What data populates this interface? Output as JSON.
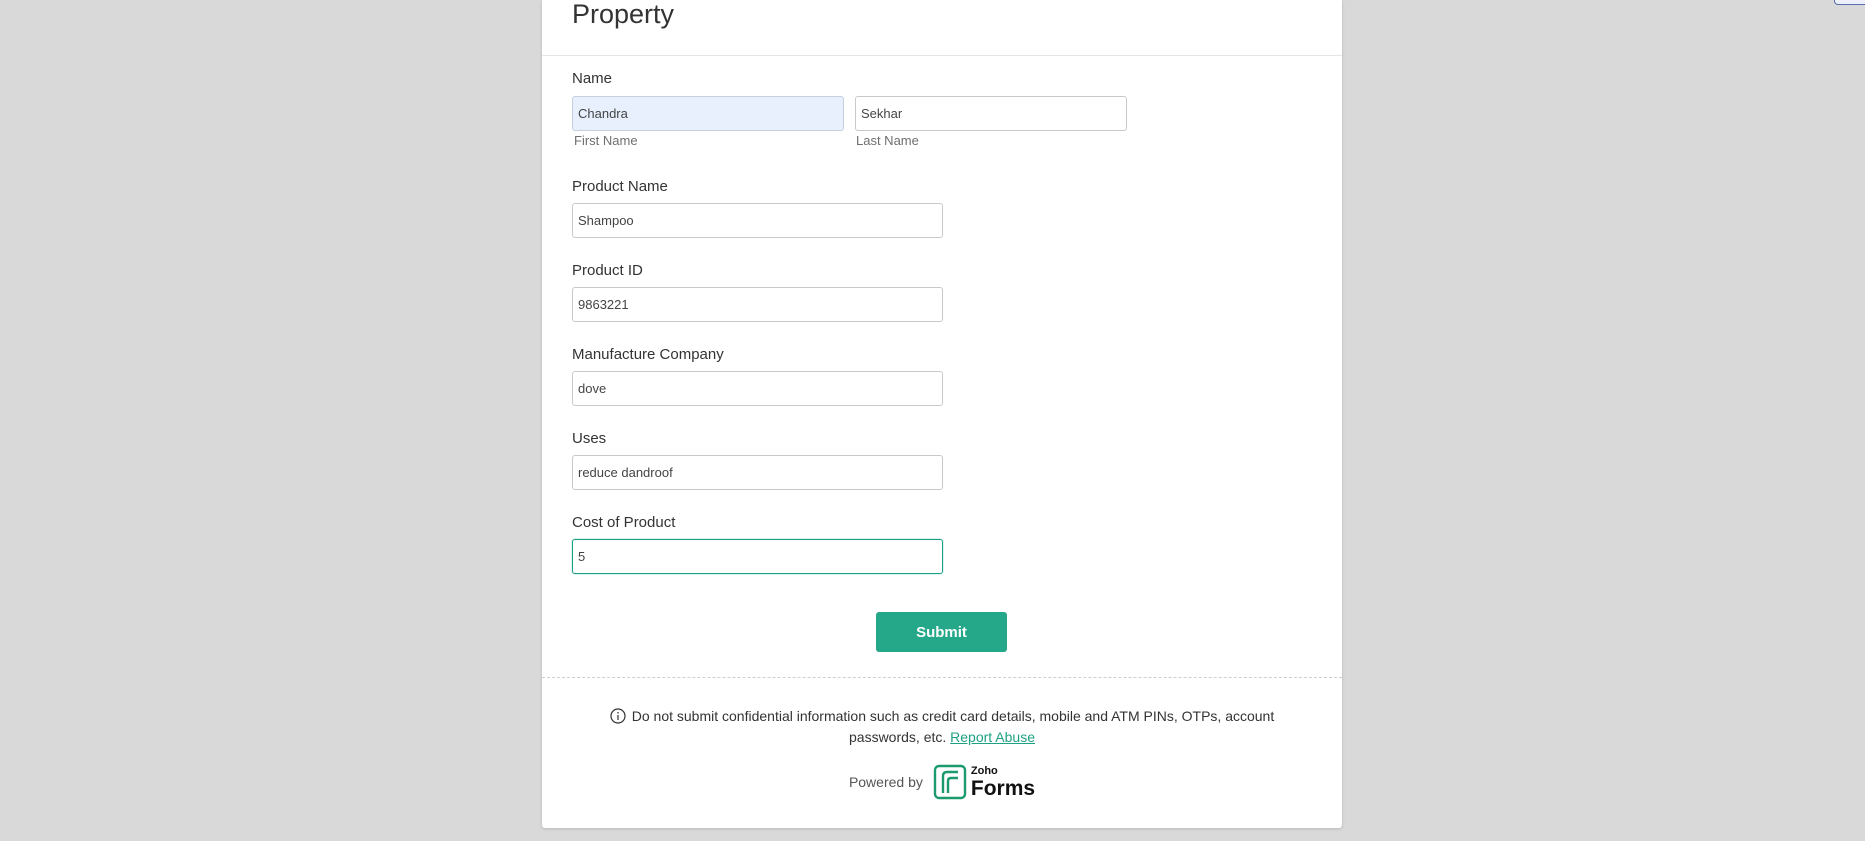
{
  "form": {
    "title": "Property"
  },
  "fields": {
    "name": {
      "label": "Name",
      "first_value": "Chandra",
      "first_sublabel": "First Name",
      "last_value": "Sekhar",
      "last_sublabel": "Last Name"
    },
    "product_name": {
      "label": "Product Name",
      "value": "Shampoo"
    },
    "product_id": {
      "label": "Product ID",
      "value": "9863221"
    },
    "manufacture_company": {
      "label": "Manufacture Company",
      "value": "dove"
    },
    "uses": {
      "label": "Uses",
      "value": "reduce dandroof"
    },
    "cost": {
      "label": "Cost of Product",
      "value": "5"
    }
  },
  "submit_label": "Submit",
  "footer": {
    "notice_text": "Do not submit confidential information such as credit card details, mobile and ATM PINs, OTPs, account passwords, etc.",
    "report_link": "Report Abuse",
    "powered_by": "Powered by",
    "logo_top": "Zoho",
    "logo_main": "Forms"
  },
  "colors": {
    "accent": "#24a889",
    "background": "#d9d9d9",
    "autofill": "#e8f0fe"
  },
  "icons": {
    "notice": "info-circle-icon",
    "logo": "zoho-forms-logo-icon"
  }
}
